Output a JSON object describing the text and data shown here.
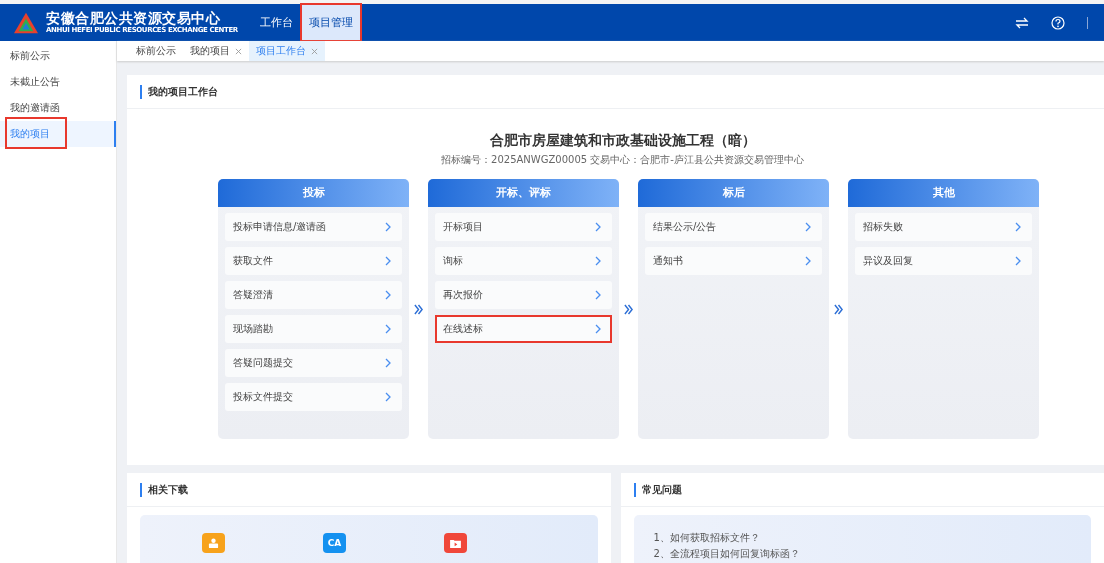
{
  "header": {
    "logo_title": "安徽合肥公共资源交易中心",
    "logo_subtitle": "ANHUI HEFEI PUBLIC RESOURCES EXCHANGE CENTER",
    "nav": [
      {
        "label": "工作台",
        "selected": false,
        "highlighted": false
      },
      {
        "label": "项目管理",
        "selected": true,
        "highlighted": true
      }
    ]
  },
  "sidebar": {
    "items": [
      {
        "label": "标前公示",
        "selected": false,
        "highlighted": false
      },
      {
        "label": "未截止公告",
        "selected": false,
        "highlighted": false
      },
      {
        "label": "我的邀请函",
        "selected": false,
        "highlighted": false
      },
      {
        "label": "我的项目",
        "selected": true,
        "highlighted": true
      }
    ]
  },
  "tabs": [
    {
      "label": "标前公示",
      "selected": false,
      "closable": false
    },
    {
      "label": "我的项目",
      "selected": false,
      "closable": true
    },
    {
      "label": "项目工作台",
      "selected": true,
      "closable": true
    }
  ],
  "workbench": {
    "heading": "我的项目工作台",
    "project_title": "合肥市房屋建筑和市政基础设施工程（暗）",
    "project_info": "招标编号：2025ANWGZ00005  交易中心：合肥市-庐江县公共资源交易管理中心",
    "stages": [
      {
        "title": "投标",
        "items": [
          {
            "label": "投标申请信息/邀请函",
            "highlighted": false
          },
          {
            "label": "获取文件",
            "highlighted": false
          },
          {
            "label": "答疑澄清",
            "highlighted": false
          },
          {
            "label": "现场踏勘",
            "highlighted": false
          },
          {
            "label": "答疑问题提交",
            "highlighted": false
          },
          {
            "label": "投标文件提交",
            "highlighted": false
          }
        ]
      },
      {
        "title": "开标、评标",
        "items": [
          {
            "label": "开标项目",
            "highlighted": false
          },
          {
            "label": "询标",
            "highlighted": false
          },
          {
            "label": "再次报价",
            "highlighted": false
          },
          {
            "label": "在线述标",
            "highlighted": true
          }
        ]
      },
      {
        "title": "标后",
        "items": [
          {
            "label": "结果公示/公告",
            "highlighted": false
          },
          {
            "label": "通知书",
            "highlighted": false
          }
        ]
      },
      {
        "title": "其他",
        "items": [
          {
            "label": "招标失败",
            "highlighted": false
          },
          {
            "label": "异议及回复",
            "highlighted": false
          }
        ]
      }
    ]
  },
  "downloads": {
    "heading": "相关下载",
    "items": [
      {
        "kind": "person"
      },
      {
        "kind": "ca",
        "icon_text": "CA"
      },
      {
        "kind": "video"
      }
    ]
  },
  "faq": {
    "heading": "常见问题",
    "items": [
      "1、如何获取招标文件？",
      "2、全流程项目如何回复询标函？"
    ]
  }
}
